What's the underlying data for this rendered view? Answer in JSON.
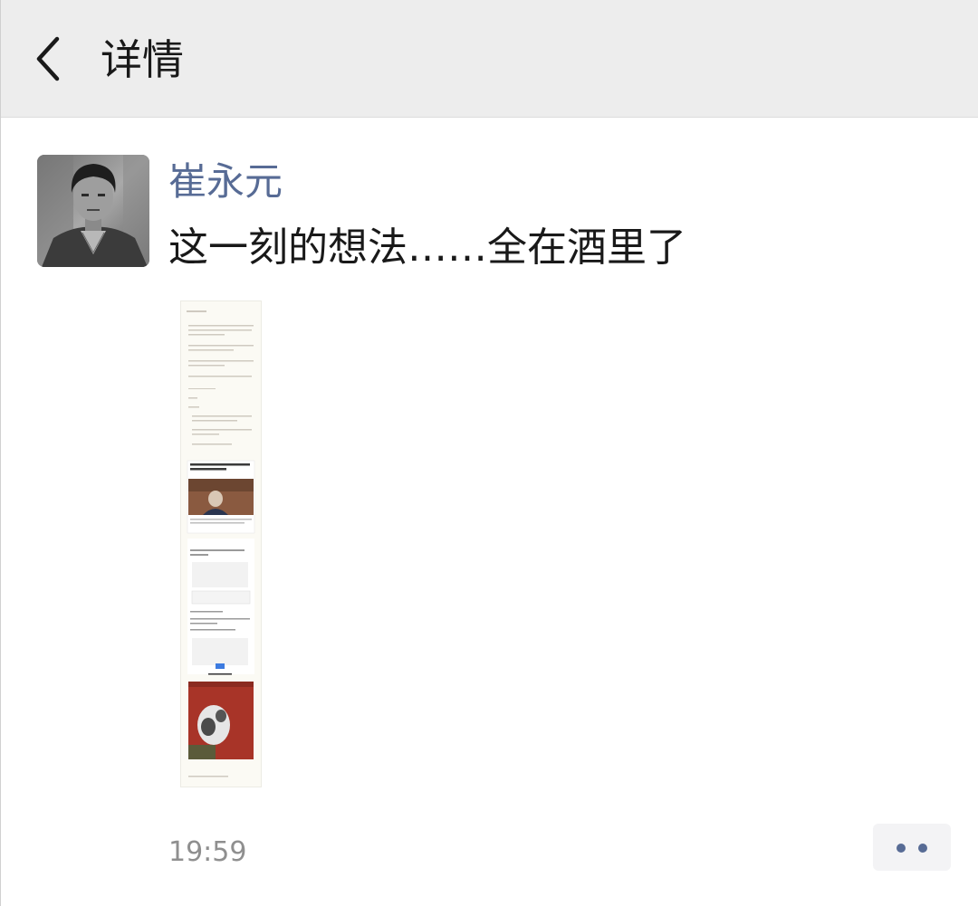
{
  "header": {
    "back_icon": "chevron-left-icon",
    "title": "详情"
  },
  "post": {
    "author": "崔永元",
    "text": "这一刻的想法……全在酒里了",
    "image_icon": "long-screenshot-image",
    "time": "19:59",
    "more_icon": "more-dots-icon"
  },
  "colors": {
    "header_bg": "#ededed",
    "name": "#576b95",
    "text": "#191919",
    "time": "#8f8f8f",
    "dots": "#576b95"
  }
}
